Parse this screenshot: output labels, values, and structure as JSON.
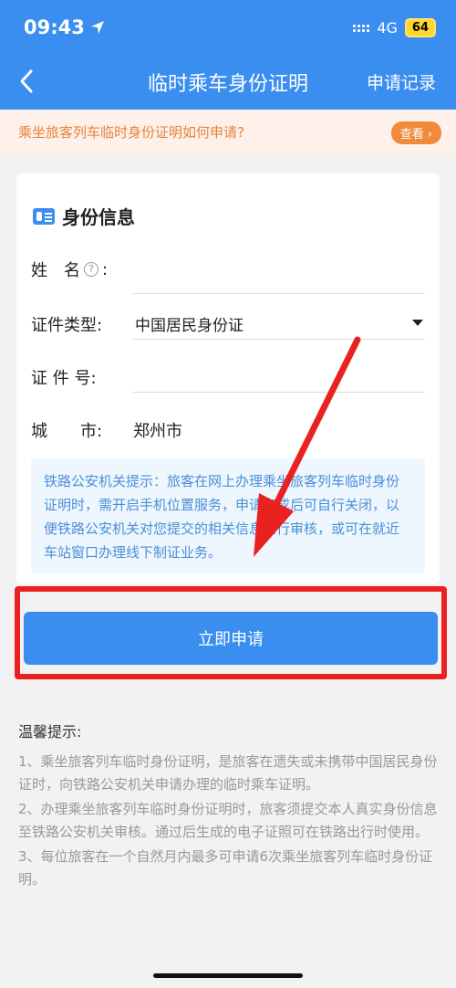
{
  "status_bar": {
    "time": "09:43",
    "network": "4G",
    "battery": "64"
  },
  "nav": {
    "title": "临时乘车身份证明",
    "right_action": "申请记录"
  },
  "notice": {
    "text": "乘坐旅客列车临时身份证明如何申请?",
    "button": "查看"
  },
  "form": {
    "section_title": "身份信息",
    "name_label": "姓　名",
    "name_help": "?",
    "name_colon": ":",
    "name_value": "",
    "id_type_label": "证件类型:",
    "id_type_value": "中国居民身份证",
    "id_number_label": "证 件 号:",
    "id_number_value": "",
    "city_label": "城　　市:",
    "city_value": "郑州市",
    "police_tip": "铁路公安机关提示：旅客在网上办理乘坐旅客列车临时身份证明时，需开启手机位置服务，申请完成后可自行关闭，以便铁路公安机关对您提交的相关信息进行审核，或可在就近车站窗口办理线下制证业务。"
  },
  "submit_button": "立即申请",
  "warm_tips": {
    "title": "温馨提示:",
    "items": [
      "1、乘坐旅客列车临时身份证明，是旅客在遗失或未携带中国居民身份证时，向铁路公安机关申请办理的临时乘车证明。",
      "2、办理乘坐旅客列车临时身份证明时，旅客须提交本人真实身份信息至铁路公安机关审核。通过后生成的电子证照可在铁路出行时使用。",
      "3、每位旅客在一个自然月内最多可申请6次乘坐旅客列车临时身份证明。"
    ]
  },
  "colors": {
    "primary": "#3a8ef0",
    "notice_text": "#e8833a",
    "highlight": "#ea2121"
  }
}
